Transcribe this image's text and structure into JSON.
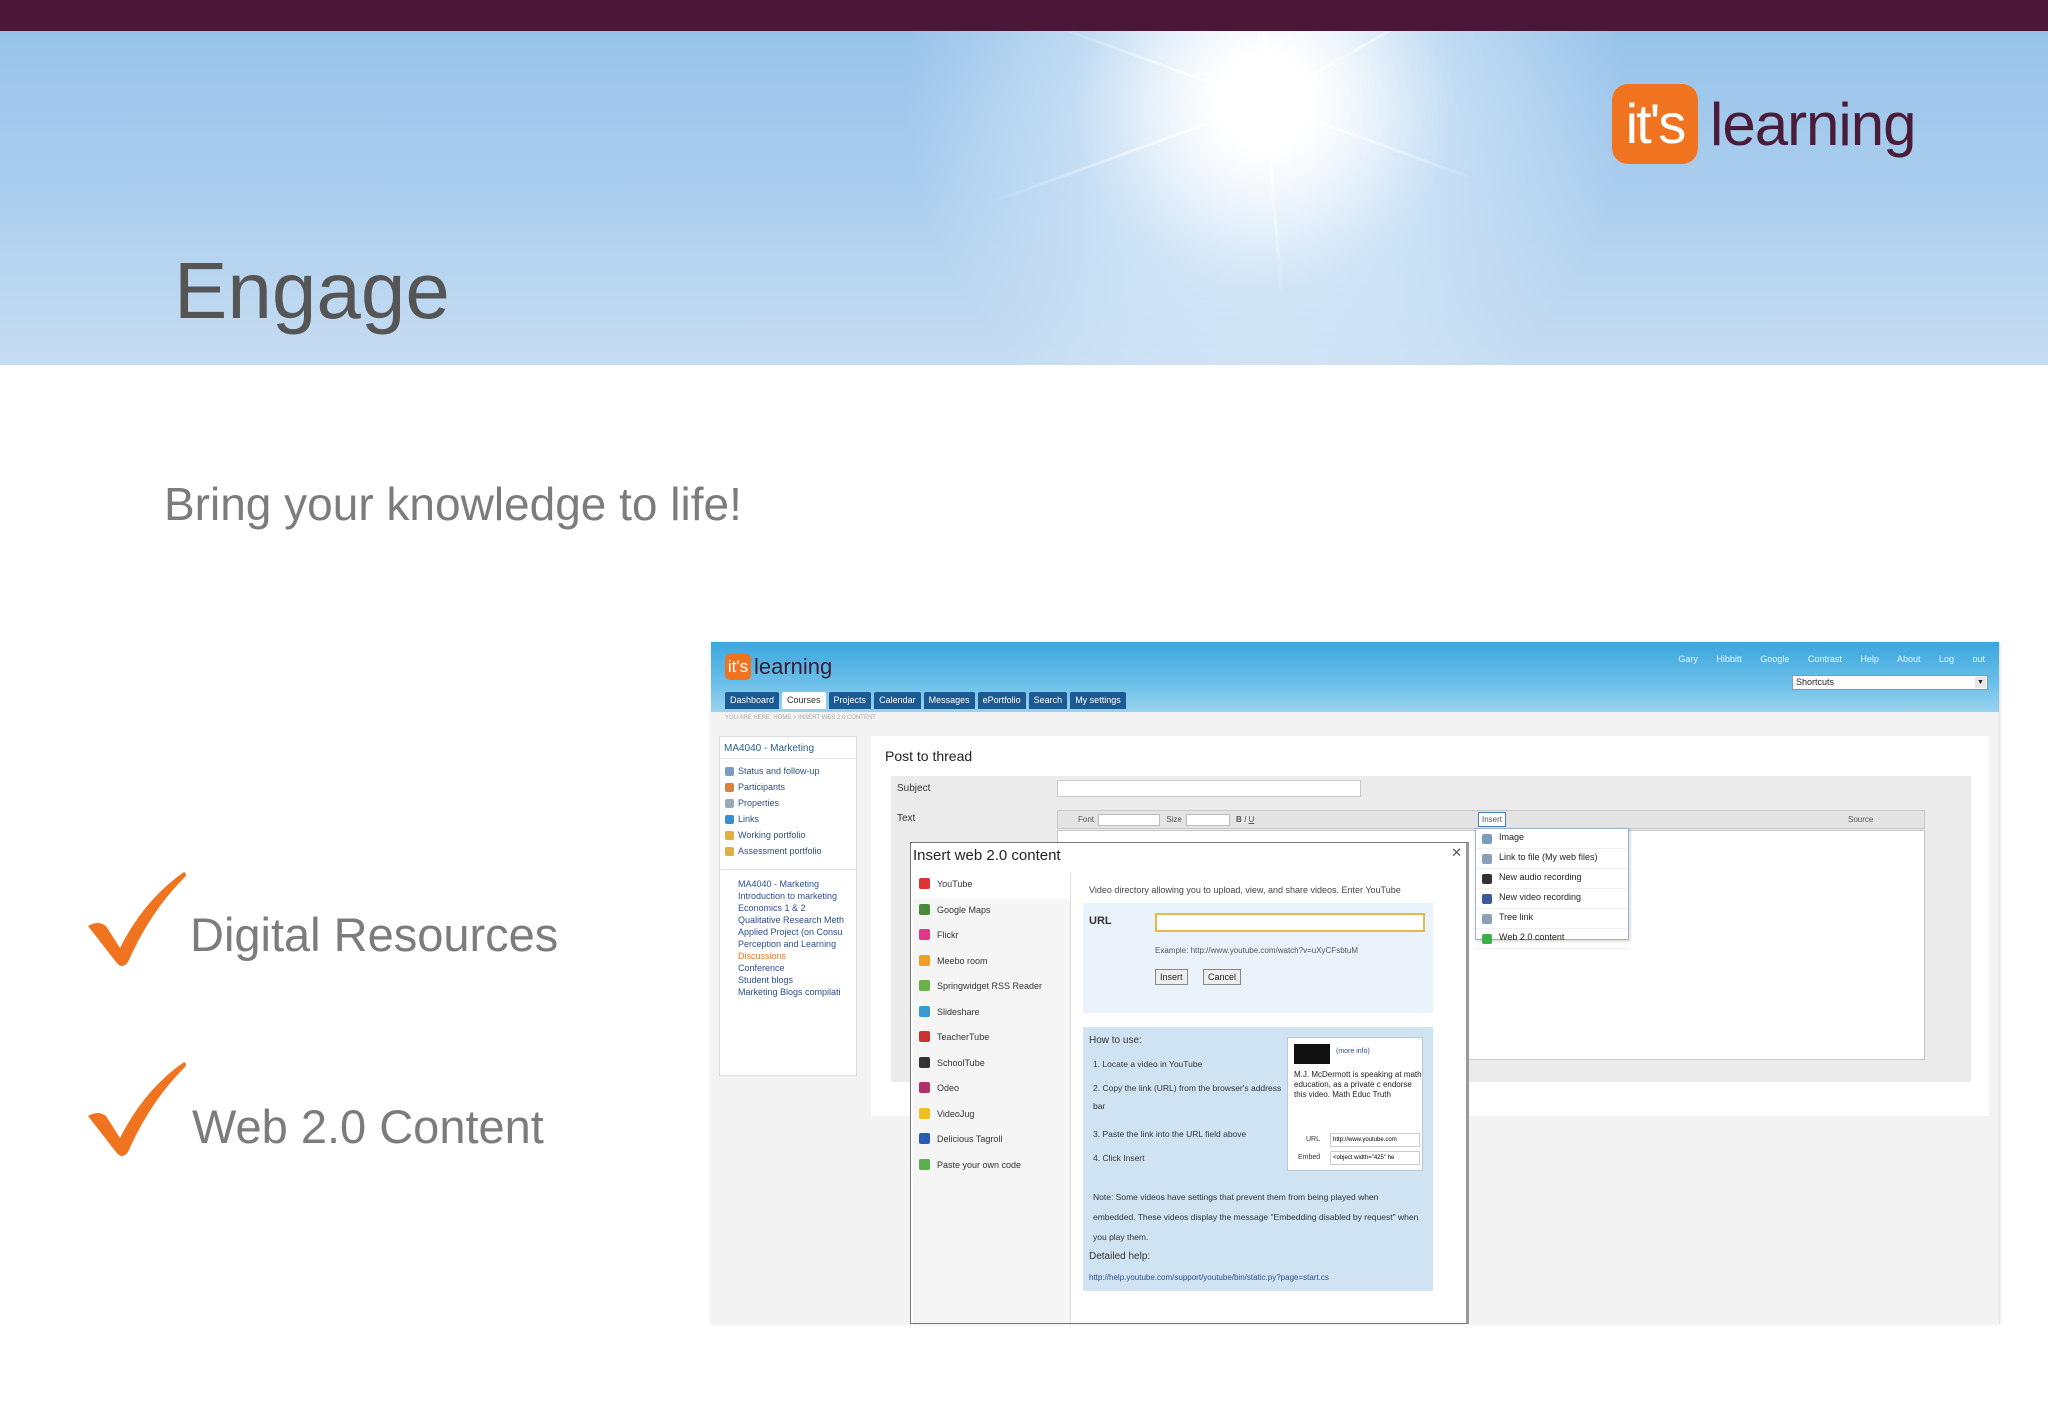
{
  "slide": {
    "title": "Engage",
    "subtitle": "Bring your knowledge to life!",
    "bullets": [
      "Digital Resources",
      "Web 2.0 Content"
    ],
    "logo": {
      "mark": "it's",
      "word": "learning"
    },
    "colors": {
      "top_bar": "#4a1836",
      "accent": "#f0731f",
      "brand": "#4a1c3a",
      "text": "#7c7c7c"
    }
  },
  "screenshot": {
    "logo": {
      "mark": "it's",
      "word": "learning"
    },
    "user_links": "Gary Hibbitt Google Contrast Help About Log out",
    "shortcuts": "Shortcuts",
    "tabs": [
      "Dashboard",
      "Courses",
      "Projects",
      "Calendar",
      "Messages",
      "ePortfolio",
      "Search",
      "My settings"
    ],
    "breadcrumb": "YOU ARE HERE: HOME > INSERT WEB 2.0 CONTENT",
    "sidebar": {
      "course": "MA4040 - Marketing",
      "items": [
        "Status and follow-up",
        "Participants",
        "Properties",
        "Links",
        "Working portfolio",
        "Assessment portfolio"
      ],
      "tree_root": "MA4040 - Marketing",
      "tree": [
        "Introduction to marketing",
        "Economics 1 & 2",
        "Qualitative Research Meth",
        "Applied Project (on Consu",
        "Perception and Learning",
        "Discussions",
        "Conference",
        "Student blogs",
        "Marketing Blogs compilati"
      ]
    },
    "post": {
      "title": "Post to thread",
      "subject_label": "Subject",
      "text_label": "Text",
      "toolbar": {
        "font": "Font",
        "size": "Size",
        "insert": "Insert",
        "source": "Source"
      }
    },
    "insert_menu": [
      "Image",
      "Link to file (My web files)",
      "New audio recording",
      "New video recording",
      "Tree link",
      "Web 2.0 content"
    ],
    "dialog": {
      "title": "Insert web 2.0 content",
      "services": [
        "YouTube",
        "Google Maps",
        "Flickr",
        "Meebo room",
        "Springwidget RSS Reader",
        "Slideshare",
        "TeacherTube",
        "SchoolTube",
        "Odeo",
        "VideoJug",
        "Delicious Tagroll",
        "Paste your own code"
      ],
      "intro": "Video directory allowing you to upload, view, and share videos. Enter YouTube",
      "url_label": "URL",
      "example": "Example: http://www.youtube.com/watch?v=uXyCFsbtuM",
      "insert": "Insert",
      "cancel": "Cancel",
      "how_title": "How to use:",
      "steps": [
        "1. Locate a video in YouTube",
        "2. Copy the link (URL) from the browser's address bar",
        "3. Paste the link into the URL field above",
        "4. Click Insert"
      ],
      "video_more": "(more info)",
      "video_desc": "M.J. McDermott is speaking at math education, as a private c endorse this video. Math Educ Truth",
      "video_url_label": "URL",
      "video_url": "http://www.youtube.com",
      "video_embed_label": "Embed",
      "video_embed": "<object width=\"425\" he",
      "note": "Note: Some videos have settings that prevent them from being played when embedded. These videos display the message \"Embedding disabled by request\" when you play them.",
      "detail_title": "Detailed help:",
      "detail_link": "http://help.youtube.com/support/youtube/bin/static.py?page=start.cs"
    }
  }
}
